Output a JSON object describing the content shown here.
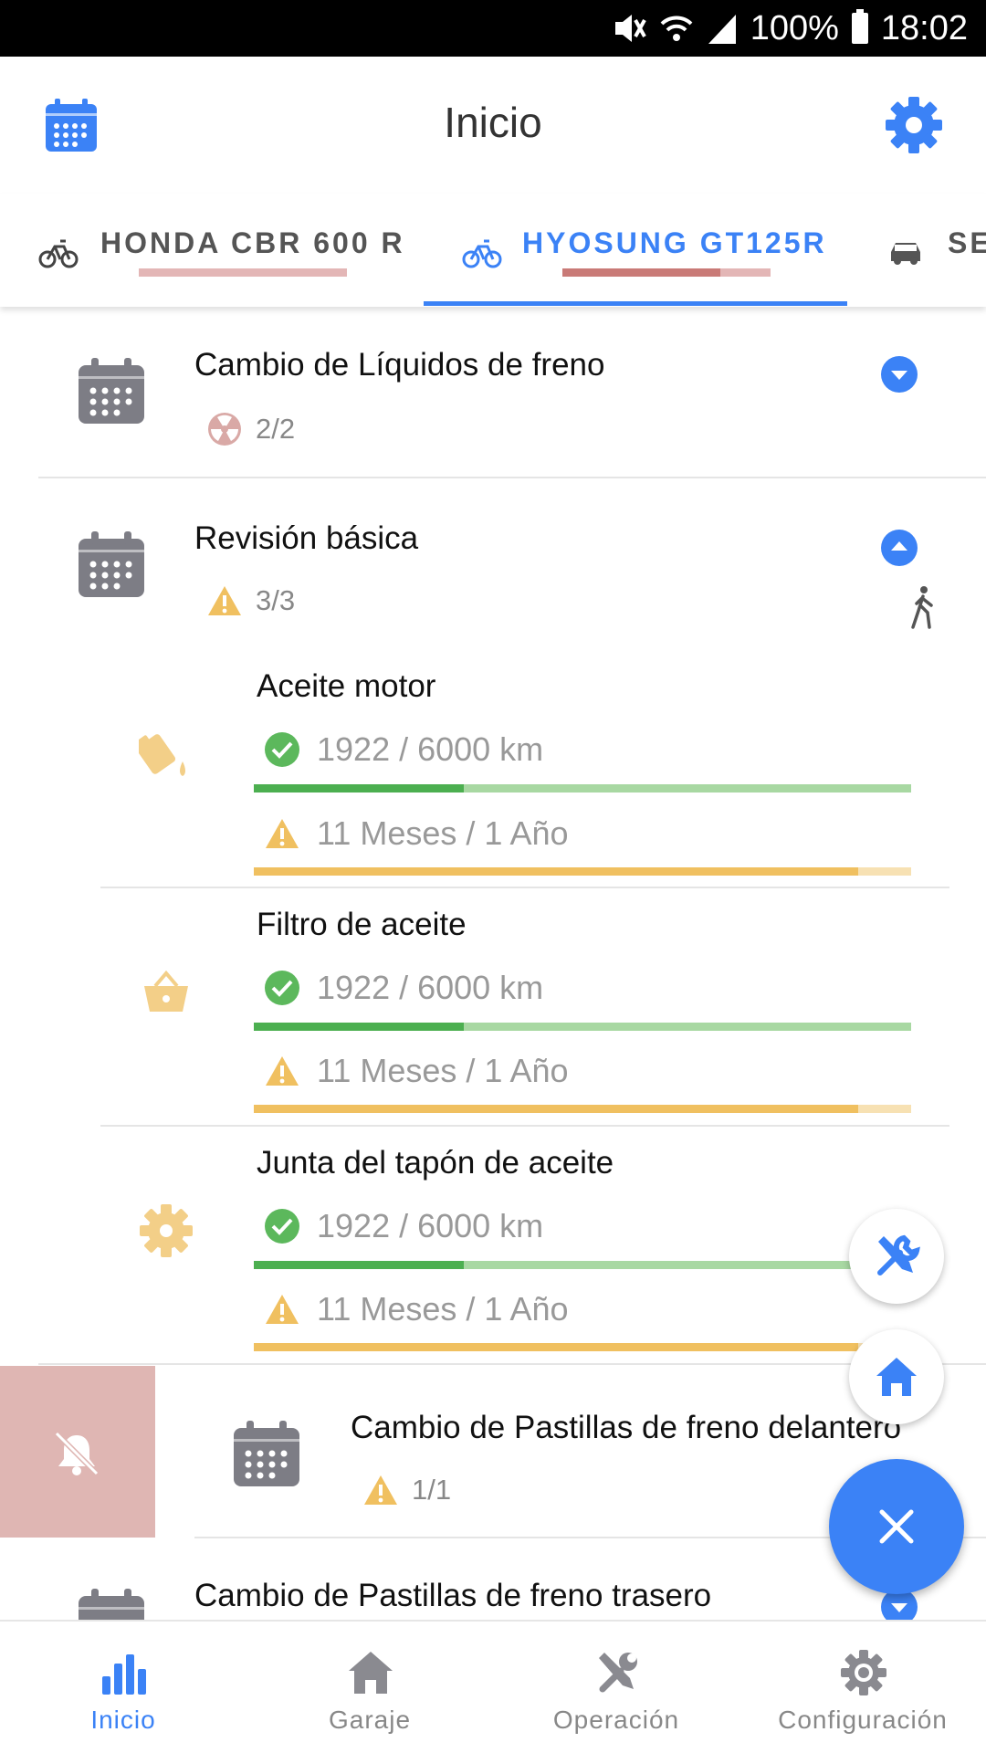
{
  "status_bar": {
    "battery": "100%",
    "time": "18:02"
  },
  "app_bar": {
    "title": "Inicio",
    "left_icon": "calendar-icon",
    "right_icon": "gear-icon"
  },
  "tabs": [
    {
      "label": "HONDA CBR 600 R",
      "icon": "bicycle-icon",
      "progress": 0,
      "active": false
    },
    {
      "label": "HYOSUNG GT125R",
      "icon": "bicycle-icon",
      "progress": 0.76,
      "active": true
    },
    {
      "label": "SE",
      "icon": "car-icon",
      "active": false
    }
  ],
  "list": [
    {
      "title": "Cambio de Líquidos de freno",
      "badge": "2/2",
      "badge_icon": "radiation-icon",
      "expanded": false
    },
    {
      "title": "Revisión básica",
      "badge": "3/3",
      "badge_icon": "warning-icon",
      "expanded": true,
      "items": [
        {
          "title": "Aceite motor",
          "icon": "oil-can-icon",
          "km": "1922 / 6000 km",
          "km_progress": 0.32,
          "time": "11 Meses / 1 Año",
          "time_progress": 0.92
        },
        {
          "title": "Filtro de aceite",
          "icon": "basket-icon",
          "km": "1922 / 6000 km",
          "km_progress": 0.32,
          "time": "11 Meses / 1 Año",
          "time_progress": 0.92
        },
        {
          "title": "Junta del tapón de aceite",
          "icon": "cog-icon",
          "km": "1922 / 6000 km",
          "km_progress": 0.32,
          "time": "11 Meses / 1 Año",
          "time_progress": 0.92
        }
      ]
    },
    {
      "title": "Cambio de Pastillas de freno delantero",
      "badge": "1/1",
      "badge_icon": "warning-icon",
      "swiped": true
    },
    {
      "title": "Cambio de Pastillas de freno trasero"
    }
  ],
  "bottom_nav": [
    {
      "label": "Inicio",
      "icon": "bar-chart-icon",
      "active": true
    },
    {
      "label": "Garaje",
      "icon": "home-icon",
      "active": false
    },
    {
      "label": "Operación",
      "icon": "tools-icon",
      "active": false
    },
    {
      "label": "Configuración",
      "icon": "gear-icon",
      "active": false
    }
  ],
  "colors": {
    "accent": "#3b82f6",
    "ok": "#4caf50",
    "warn": "#f0c060",
    "danger": "#d9a9a6",
    "icon_gray": "#7d7d85"
  }
}
